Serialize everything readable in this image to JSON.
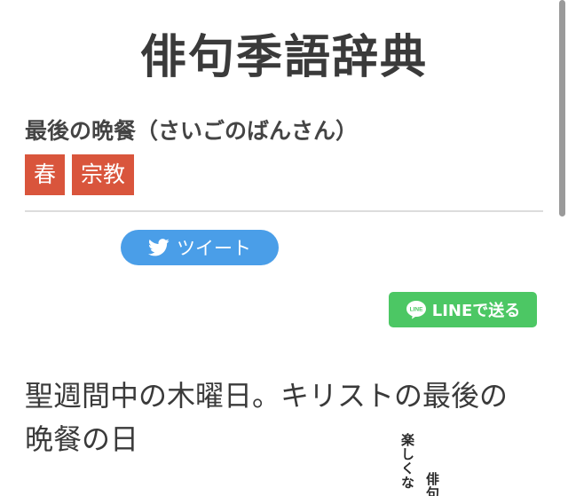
{
  "site": {
    "title": "俳句季語辞典"
  },
  "entry": {
    "heading": "最後の晩餐（さいごのばんさん）",
    "tags": [
      {
        "label": "春"
      },
      {
        "label": "宗教"
      }
    ],
    "description": "聖週間中の木曜日。キリストの最後の晩餐の日"
  },
  "share": {
    "tweet_label": "ツイート",
    "line_label": "LINEで送る",
    "line_icon_text": "LINE"
  },
  "ad": {
    "col1": "楽しくな",
    "col2": "俳句"
  },
  "colors": {
    "tag_bg": "#d9553c",
    "tweet_bg": "#4a9ee8",
    "line_bg": "#4cc764"
  },
  "icons": {
    "tweet": "twitter-bird-icon",
    "line": "line-logo-icon"
  }
}
